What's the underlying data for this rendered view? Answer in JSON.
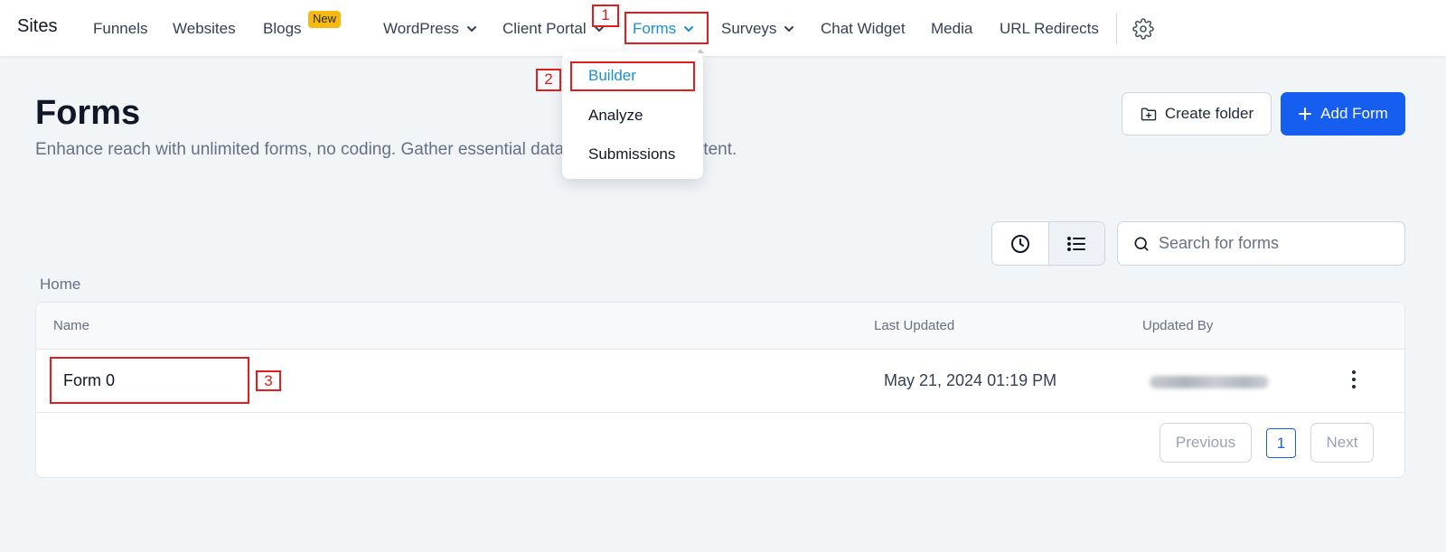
{
  "nav": {
    "brand": "Sites",
    "items": [
      {
        "label": "Funnels"
      },
      {
        "label": "Websites"
      },
      {
        "label": "Blogs",
        "badge": "New"
      },
      {
        "label": "WordPress"
      },
      {
        "label": "Client Portal"
      },
      {
        "label": "Forms"
      },
      {
        "label": "Surveys"
      },
      {
        "label": "Chat Widget"
      },
      {
        "label": "Media"
      },
      {
        "label": "URL Redirects"
      }
    ],
    "settings_icon": "gear-icon"
  },
  "dropdown": {
    "items": [
      {
        "label": "Builder"
      },
      {
        "label": "Analyze"
      },
      {
        "label": "Submissions"
      }
    ]
  },
  "annotations": [
    "1",
    "2",
    "3"
  ],
  "header": {
    "title": "Forms",
    "description": "Enhance reach with unlimited forms, no coding. Gather essential data, personalized content.",
    "create_folder": "Create folder",
    "add_form": "Add Form"
  },
  "toolbar": {
    "search_placeholder": "Search for forms"
  },
  "breadcrumb": "Home",
  "table": {
    "columns": [
      "Name",
      "Last Updated",
      "Updated By"
    ],
    "rows": [
      {
        "name": "Form 0",
        "last_updated": "May 21, 2024 01:19 PM",
        "updated_by": ""
      }
    ]
  },
  "pagination": {
    "previous": "Previous",
    "current": "1",
    "next": "Next"
  },
  "colors": {
    "accent": "#155eef",
    "active_nav": "#1b8fd1",
    "annotation": "#e11d1d",
    "badge": "#f7b90f"
  }
}
